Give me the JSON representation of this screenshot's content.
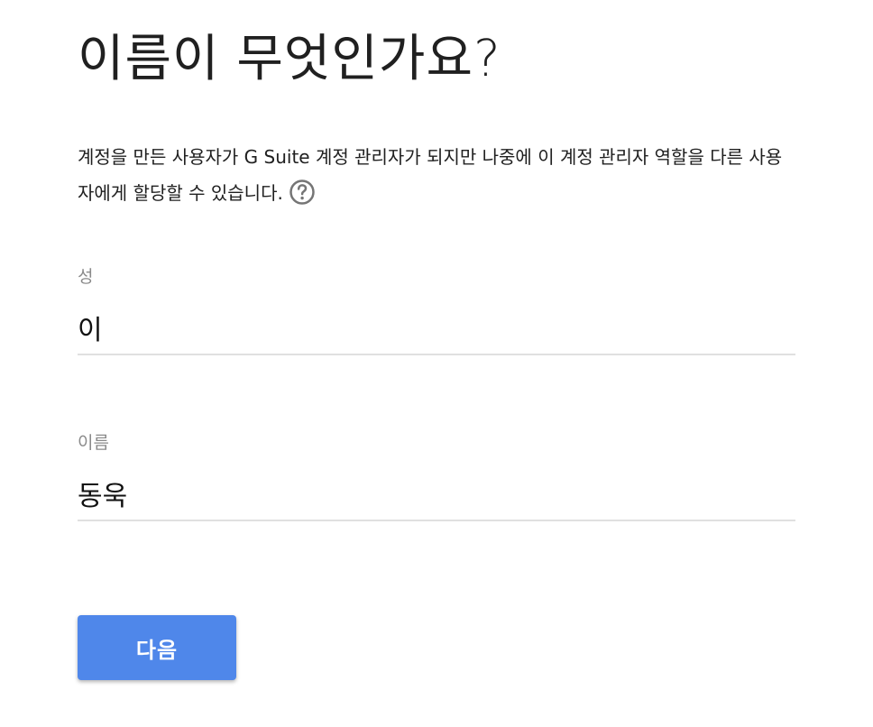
{
  "page": {
    "title": "이름이 무엇인가요?",
    "description": "계정을 만든 사용자가 G Suite 계정 관리자가 되지만 나중에 이 계정 관리자 역할을 다른 사용자에게 할당할 수 있습니다.",
    "help_icon": "help-circle-icon"
  },
  "form": {
    "last_name": {
      "label": "성",
      "value": "이"
    },
    "first_name": {
      "label": "이름",
      "value": "동욱"
    }
  },
  "actions": {
    "next_label": "다음",
    "button_color": "#4f87ea"
  }
}
